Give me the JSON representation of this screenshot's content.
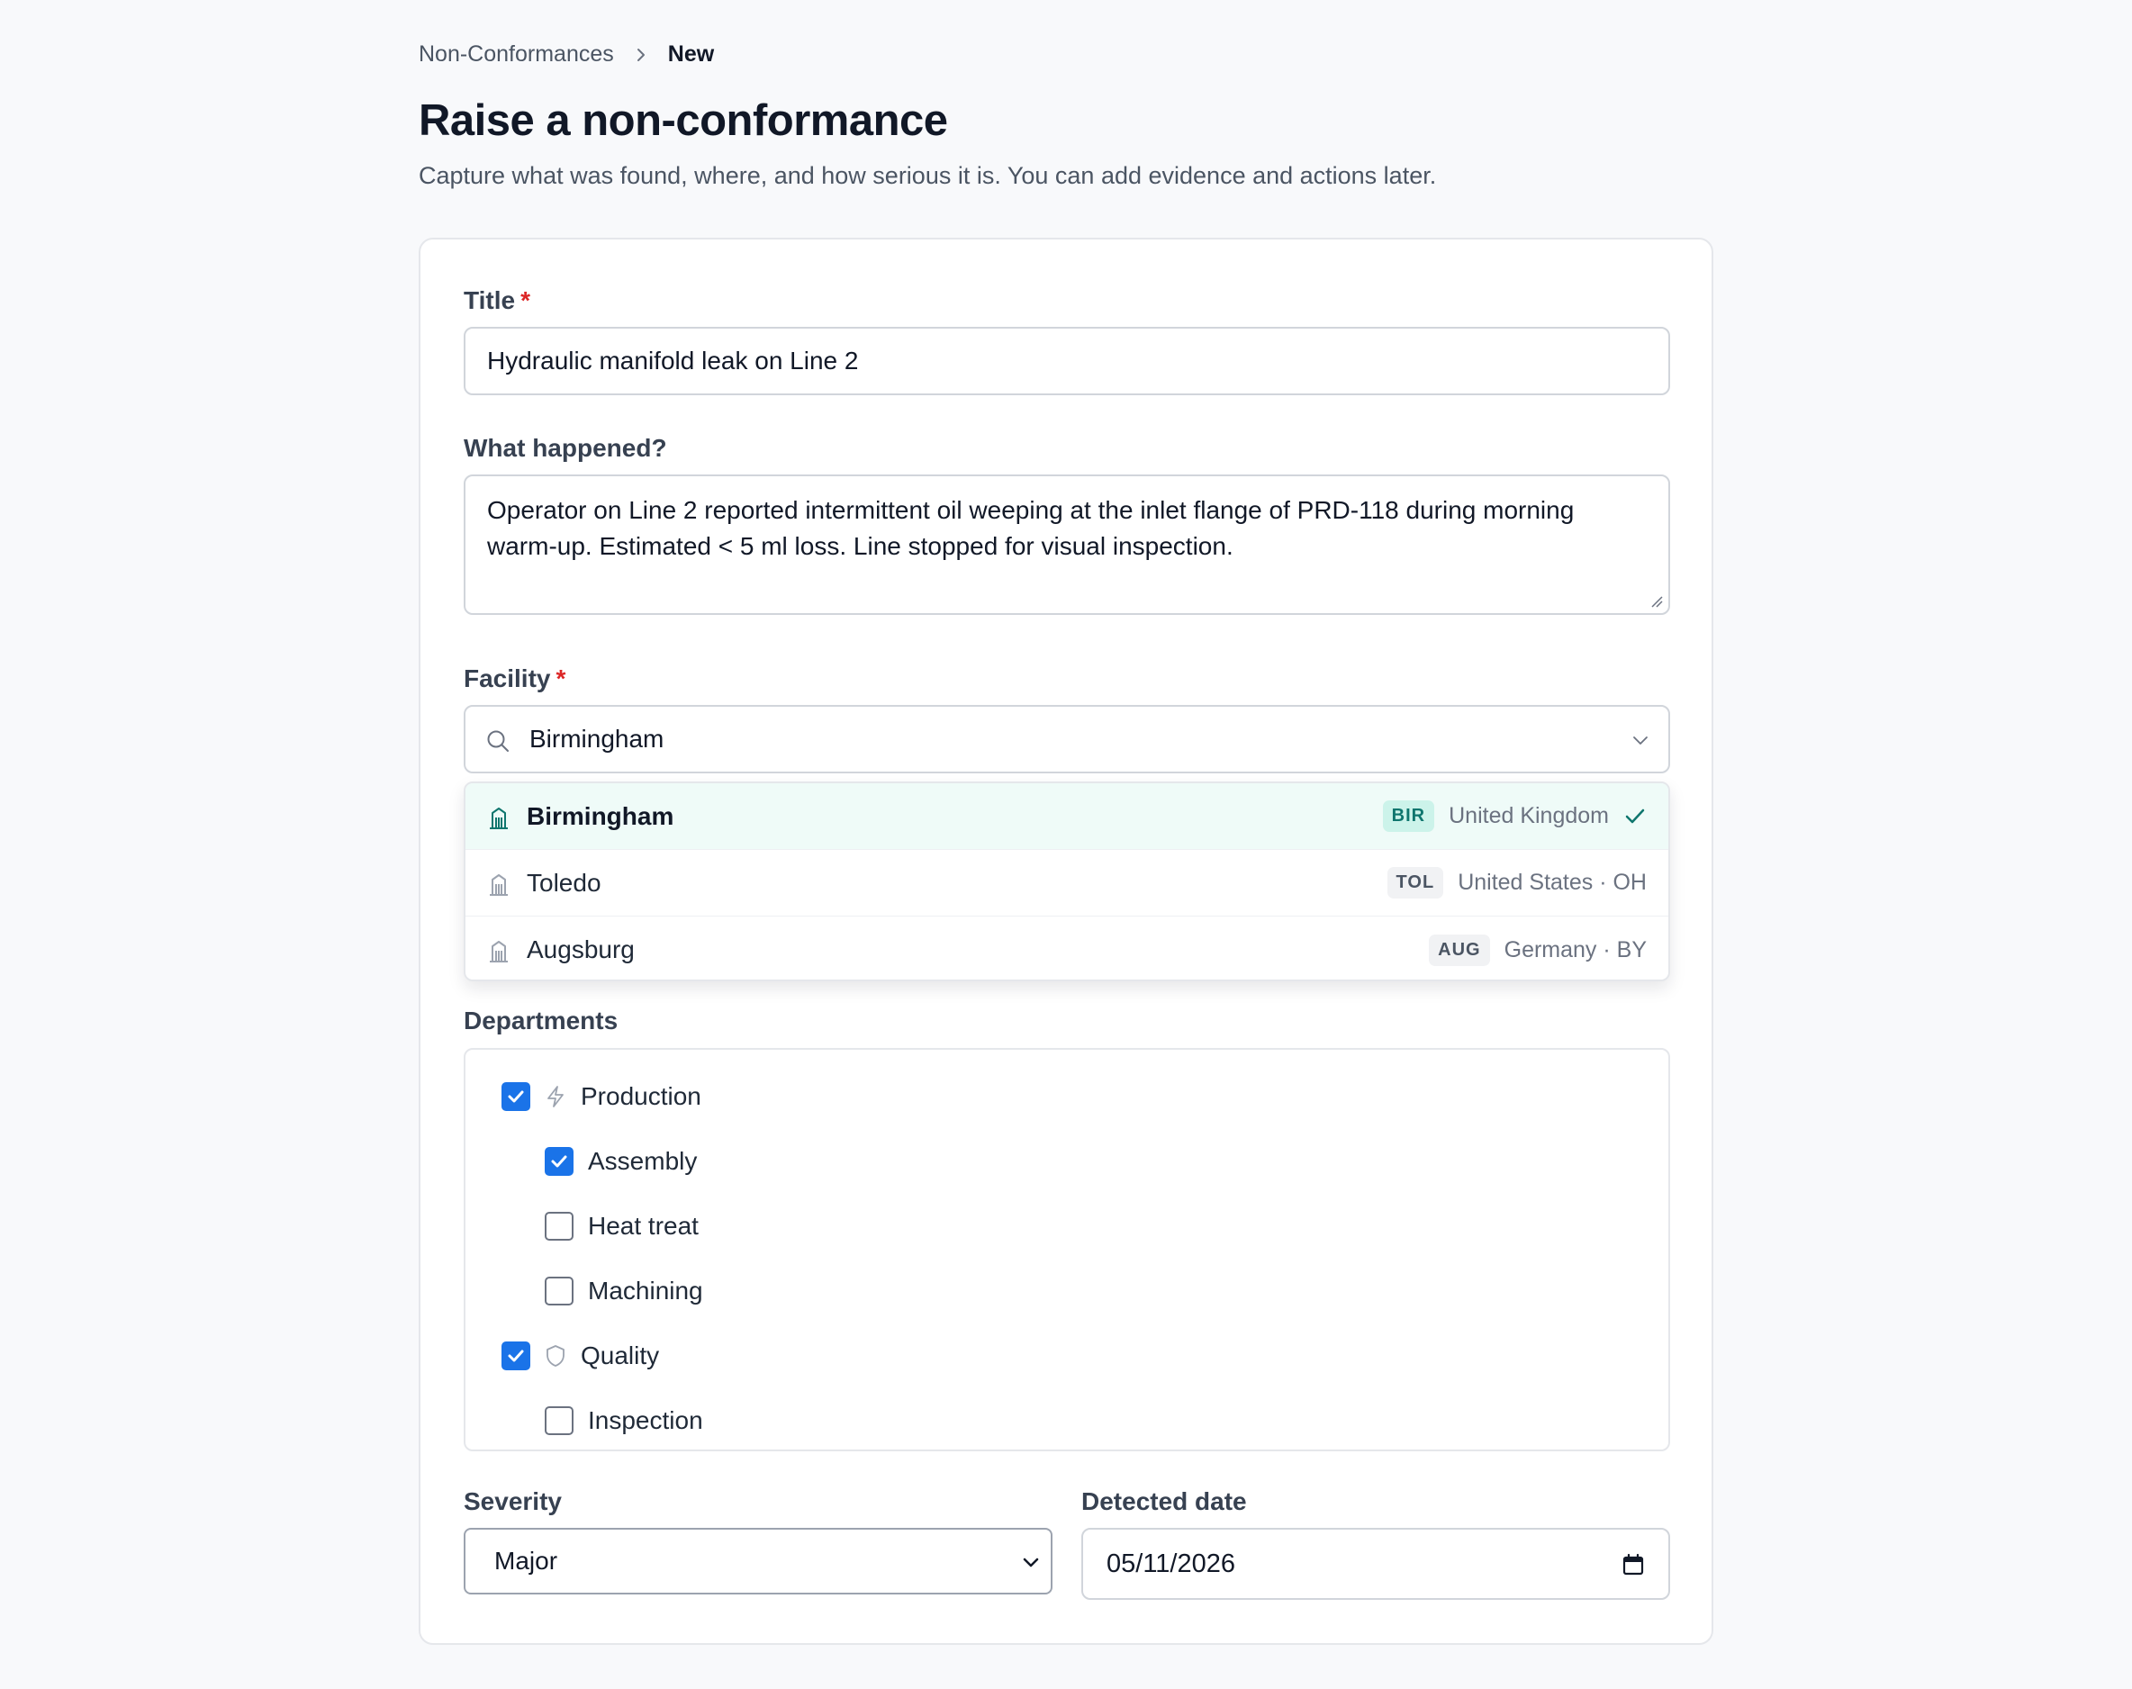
{
  "breadcrumb": {
    "parent": "Non-Conformances",
    "current": "New"
  },
  "header": {
    "title": "Raise a non-conformance",
    "subtitle": "Capture what was found, where, and how serious it is. You can add evidence and actions later."
  },
  "form": {
    "title": {
      "label": "Title",
      "required_mark": "*",
      "value": "Hydraulic manifold leak on Line 2"
    },
    "description": {
      "label": "What happened?",
      "value": "Operator on Line 2 reported intermittent oil weeping at the inlet flange of PRD-118 during morning warm-up. Estimated < 5 ml loss. Line stopped for visual inspection."
    },
    "facility": {
      "label": "Facility",
      "required_mark": "*",
      "search_value": "Birmingham",
      "options": [
        {
          "name": "Birmingham",
          "code": "BIR",
          "region": "United Kingdom",
          "selected": true
        },
        {
          "name": "Toledo",
          "code": "TOL",
          "region": "United States · OH",
          "selected": false
        },
        {
          "name": "Augsburg",
          "code": "AUG",
          "region": "Germany · BY",
          "selected": false
        }
      ]
    },
    "departments": {
      "label": "Departments",
      "items": [
        {
          "label": "Production",
          "checked": true,
          "icon": "lightning-icon"
        },
        {
          "label": "Assembly",
          "checked": true
        },
        {
          "label": "Heat treat",
          "checked": false
        },
        {
          "label": "Machining",
          "checked": false
        },
        {
          "label": "Quality",
          "checked": true,
          "icon": "shield-icon"
        },
        {
          "label": "Inspection",
          "checked": false
        }
      ]
    },
    "severity": {
      "label": "Severity",
      "value": "Major"
    },
    "detected_date": {
      "label": "Detected date",
      "value": "05/11/2026"
    }
  },
  "colors": {
    "accent": "#1a73e8",
    "teal": "#0f766e",
    "required": "#dc2626"
  }
}
